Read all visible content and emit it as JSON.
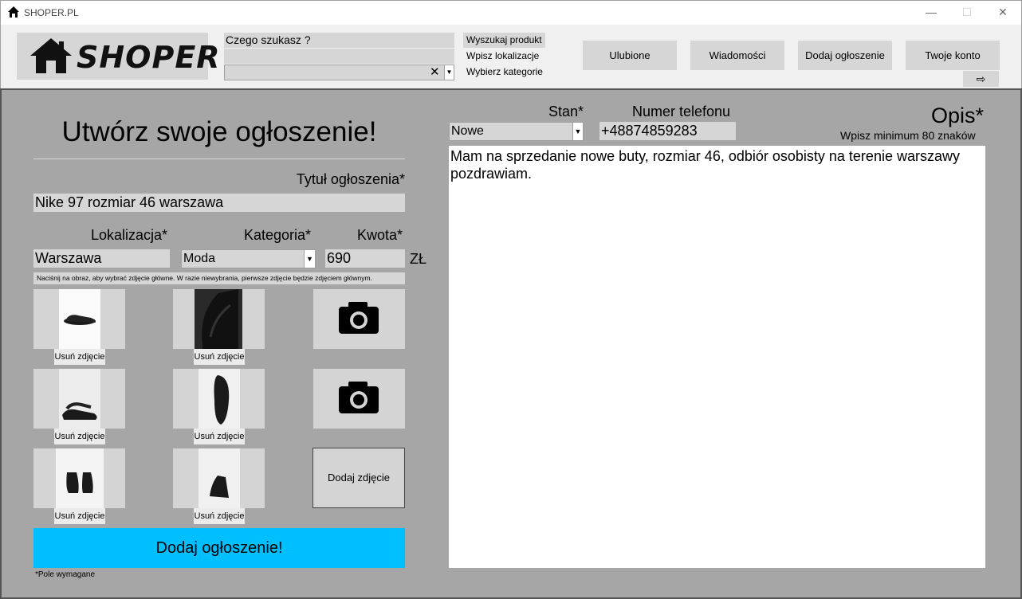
{
  "window": {
    "title": "SHOPER.PL",
    "minimize": "—",
    "maximize": "☐",
    "close": "✕"
  },
  "header": {
    "logo_text": "SHOPER",
    "search_placeholder": "Czego szukasz ?",
    "search_product": "Wyszukaj produkt",
    "enter_location": "Wpisz lokalizacje",
    "choose_category": "Wybierz kategorie",
    "clear_symbol": "✕",
    "dropdown_symbol": "▼",
    "nav": [
      "Ulubione",
      "Wiadomości",
      "Dodaj ogłoszenie",
      "Twoje konto"
    ],
    "logout_symbol": "⇨"
  },
  "form": {
    "title": "Utwórz swoje ogłoszenie!",
    "title_label": "Tytuł ogłoszenia*",
    "title_value": "Nike 97 rozmiar 46 warszawa",
    "location_label": "Lokalizacja*",
    "location_value": "Warszawa",
    "category_label": "Kategoria*",
    "category_value": "Moda",
    "price_label": "Kwota*",
    "price_value": "690",
    "currency": "ZŁ",
    "photo_hint": "Naciśnij na obraz, aby wybrać zdjęcie główne. W razie niewybrania, pierwsze zdjęcie będzie zdjęciem głównym.",
    "remove_photo": "Usuń zdjęcie",
    "add_photo": "Dodaj zdjęcie",
    "submit": "Dodaj ogłoszenie!",
    "required_note": "*Pole wymagane",
    "condition_label": "Stan*",
    "condition_value": "Nowe",
    "phone_label": "Numer telefonu",
    "phone_value": "+48874859283",
    "description_label": "Opis*",
    "description_hint": "Wpisz minimum 80 znaków",
    "description_value": "Mam na sprzedanie nowe buty, rozmiar 46, odbiór osobisty na terenie warszawy pozdrawiam."
  },
  "colors": {
    "main_bg": "#a6a6a6",
    "field_bg": "#d6d6d6",
    "submit_bg": "#00bfff"
  }
}
